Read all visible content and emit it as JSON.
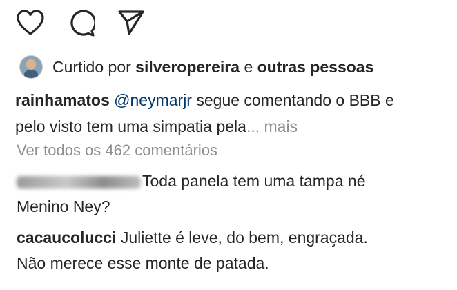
{
  "actions": {
    "like_icon": "heart-icon",
    "comment_icon": "comment-icon",
    "share_icon": "send-icon"
  },
  "likes": {
    "prefix": "Curtido por",
    "user": "silveropereira",
    "joiner": "e",
    "others": "outras pessoas"
  },
  "caption": {
    "username": "rainhamatos",
    "mention": "@neymarjr",
    "line1_text": "segue comentando o BBB e",
    "line2_text": "pelo visto tem uma simpatia pela",
    "ellipsis": "...",
    "more": "mais"
  },
  "view_all_comments": "Ver todos os 462 comentários",
  "comments": [
    {
      "username": "",
      "line1": "Toda panela tem uma tampa né",
      "line2": "Menino Ney?"
    },
    {
      "username": "cacaucolucci",
      "line1": "Juliette é leve, do bem, engraçada.",
      "line2": "Não merece esse monte de patada."
    }
  ]
}
